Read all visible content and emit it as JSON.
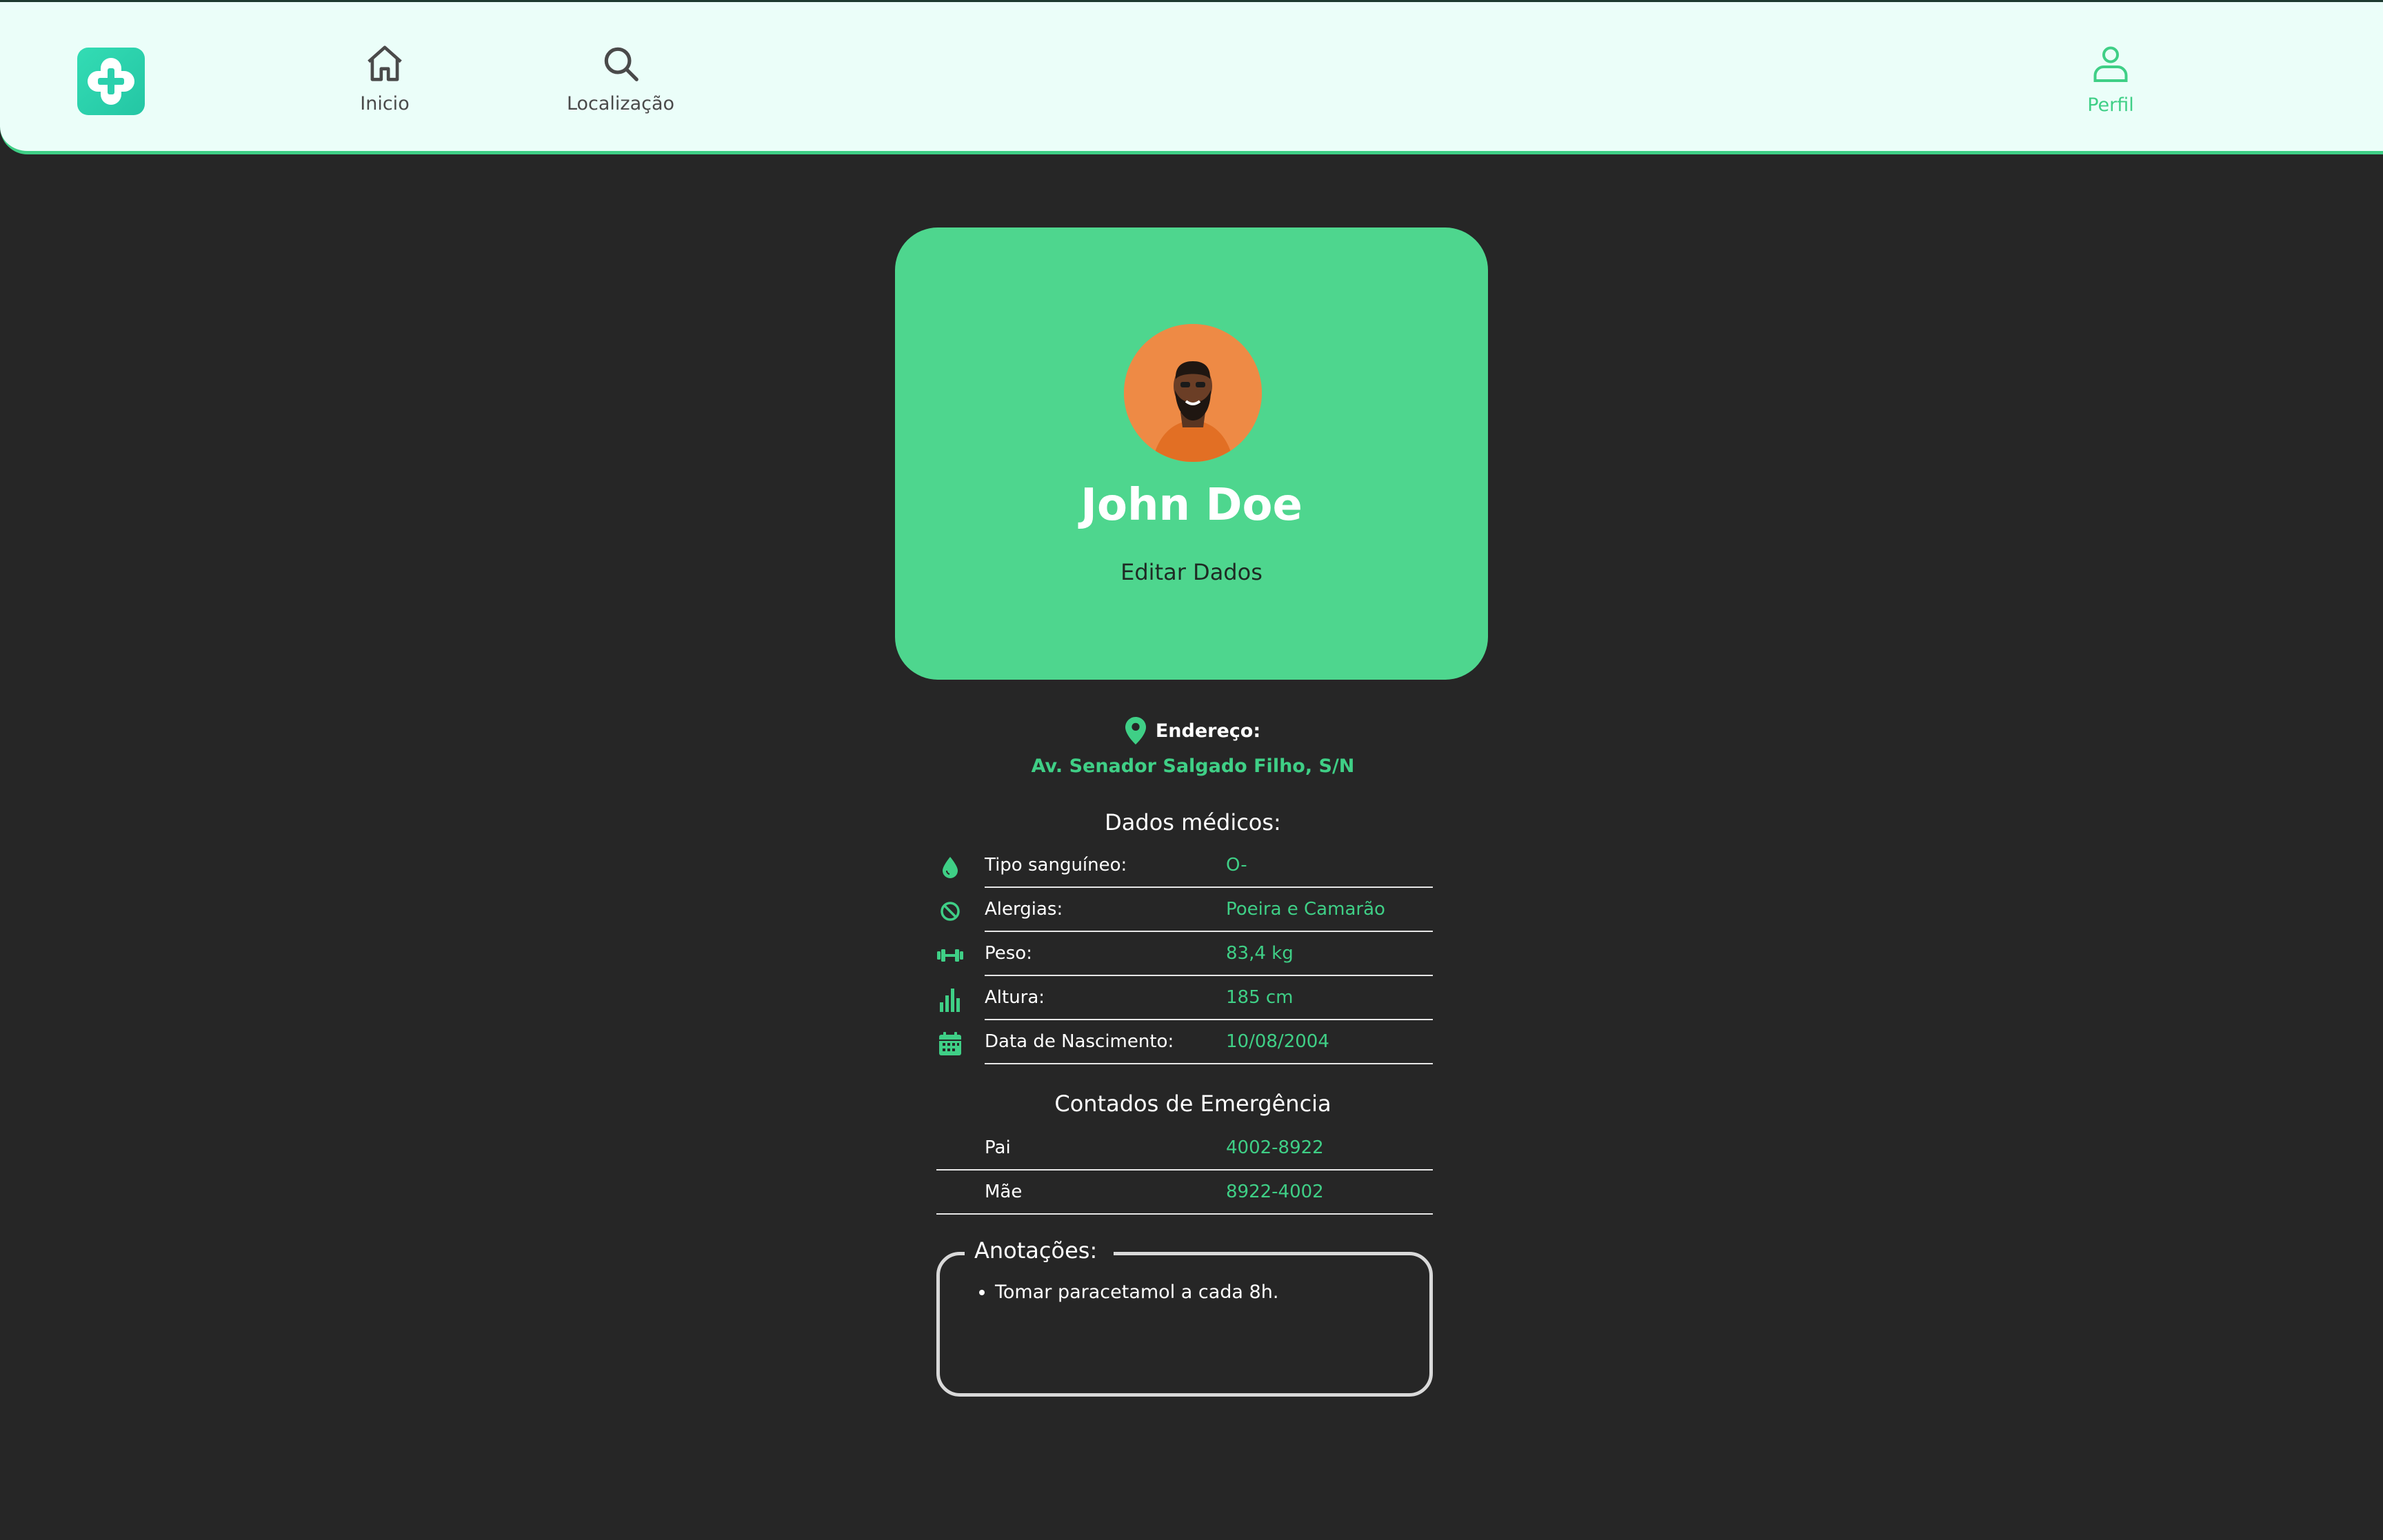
{
  "header": {
    "logo_icon": "medical-cross-logo",
    "nav": {
      "home_label": "Inicio",
      "location_label": "Localização",
      "profile_label": "Perfil"
    }
  },
  "profile": {
    "name": "John Doe",
    "edit_label": "Editar Dados"
  },
  "address": {
    "label": "Endereço:",
    "value": "Av. Senador Salgado Filho, S/N"
  },
  "medical": {
    "title": "Dados médicos:",
    "rows": [
      {
        "icon": "blood-drop-icon",
        "label": "Tipo sanguíneo:",
        "value": "O-"
      },
      {
        "icon": "ban-icon",
        "label": "Alergias:",
        "value": "Poeira e Camarão"
      },
      {
        "icon": "dumbbell-icon",
        "label": "Peso:",
        "value": "83,4 kg"
      },
      {
        "icon": "bar-chart-icon",
        "label": "Altura:",
        "value": "185 cm"
      },
      {
        "icon": "calendar-icon",
        "label": "Data de Nascimento:",
        "value": "10/08/2004"
      }
    ]
  },
  "emergency": {
    "title": "Contados de Emergência",
    "contacts": [
      {
        "label": "Pai",
        "value": "4002-8922"
      },
      {
        "label": "Mãe",
        "value": "8922-4002"
      }
    ]
  },
  "notes": {
    "title": "Anotações:",
    "items": [
      "Tomar paracetamol a cada 8h."
    ]
  },
  "colors": {
    "accent": "#3fcf86",
    "card": "#4ed68e",
    "background": "#262626",
    "header": "#ebfef9"
  }
}
